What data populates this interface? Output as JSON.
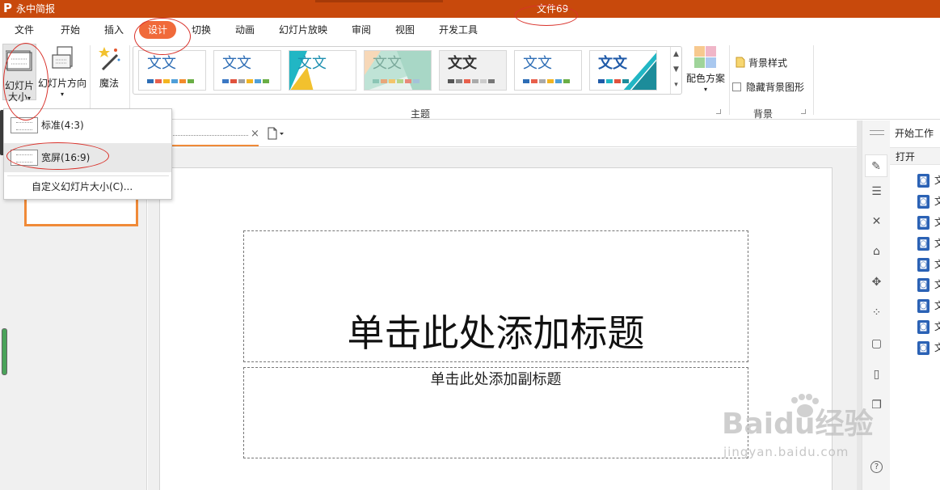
{
  "app": {
    "name": "永中简报",
    "doc_title": "文件69",
    "logo_letter": "P"
  },
  "menu": {
    "tabs": [
      {
        "label": "文件"
      },
      {
        "label": "开始"
      },
      {
        "label": "插入"
      },
      {
        "label": "设计",
        "active": true
      },
      {
        "label": "切换"
      },
      {
        "label": "动画"
      },
      {
        "label": "幻灯片放映"
      },
      {
        "label": "审阅"
      },
      {
        "label": "视图"
      },
      {
        "label": "开发工具"
      }
    ]
  },
  "ribbon": {
    "slide_size": {
      "label_line1": "幻灯片",
      "label_line2": "大小"
    },
    "slide_orientation": {
      "label": "幻灯片方向"
    },
    "magic": {
      "label": "魔法"
    },
    "theme_group": {
      "label": "主题",
      "theme_text": "文文",
      "theme_count": 7
    },
    "color_scheme": {
      "label": "配色方案"
    },
    "background_group": {
      "label": "背景",
      "bg_style": "背景样式",
      "hide_bg": "隐藏背景图形",
      "hide_bg_checked": false
    }
  },
  "dropdown": {
    "items": [
      {
        "label": "标准(4:3)",
        "selected": false
      },
      {
        "label": "宽屏(16:9)",
        "selected": true
      }
    ],
    "custom_label": "自定义幻灯片大小(C)..."
  },
  "slide": {
    "title_placeholder": "单击此处添加标题",
    "subtitle_placeholder": "单击此处添加副标题"
  },
  "task_pane": {
    "title": "开始工作",
    "open_label": "打开",
    "file_items": [
      "文",
      "文",
      "文",
      "文",
      "文",
      "文",
      "文",
      "文",
      "文"
    ]
  },
  "watermark": {
    "brand": "Baidu经验",
    "url": "jingyan.baidu.com"
  },
  "colors": {
    "titlebar": "#c8490c",
    "active_tab": "#f06a3a",
    "selection_orange": "#f08a38",
    "annotation_red": "#d9322b"
  }
}
